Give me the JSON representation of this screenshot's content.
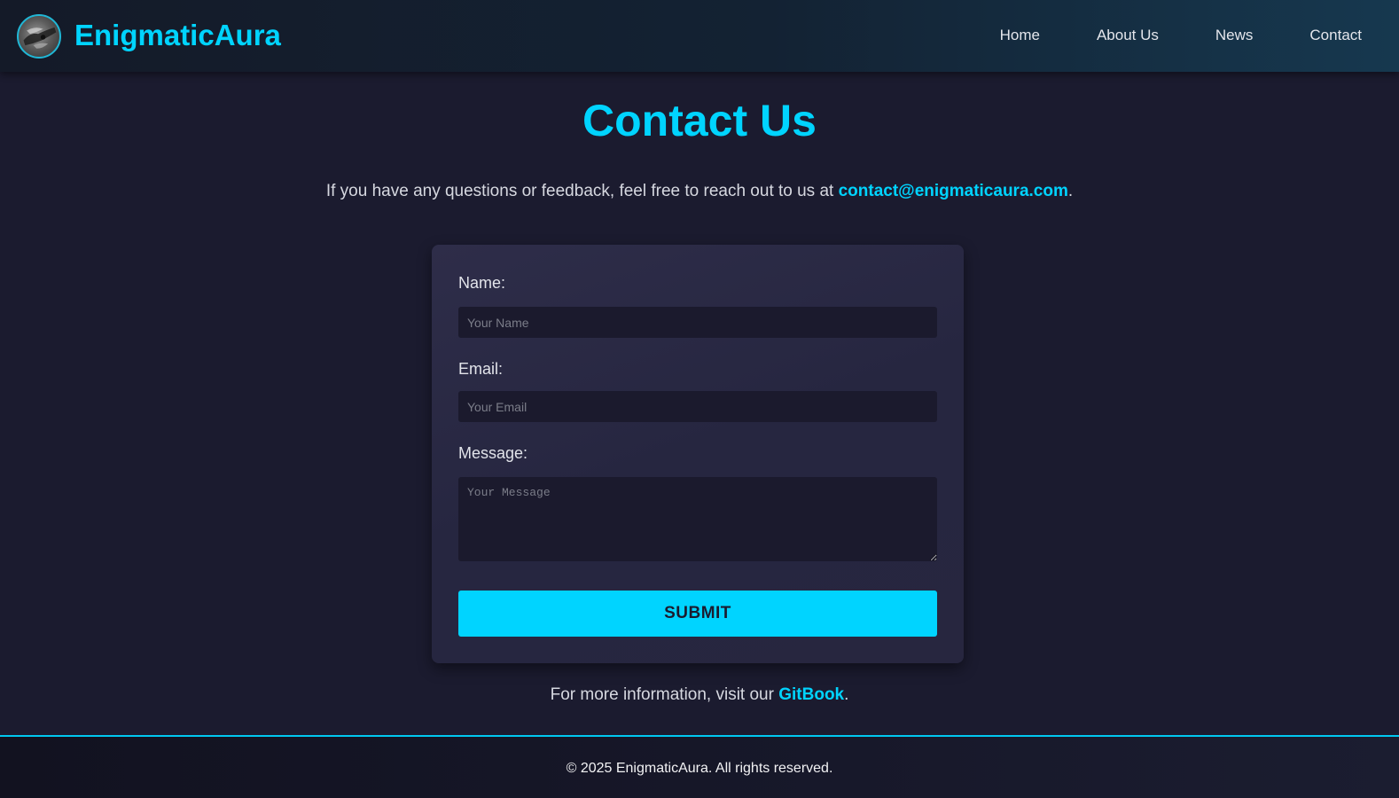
{
  "header": {
    "brand": "EnigmaticAura",
    "nav": [
      {
        "label": "Home"
      },
      {
        "label": "About Us"
      },
      {
        "label": "News"
      },
      {
        "label": "Contact"
      }
    ]
  },
  "main": {
    "title": "Contact Us",
    "intro_text": "If you have any questions or feedback, feel free to reach out to us at ",
    "intro_email": "contact@enigmaticaura.com",
    "intro_end": ".",
    "form": {
      "name_label": "Name:",
      "name_placeholder": "Your Name",
      "email_label": "Email:",
      "email_placeholder": "Your Email",
      "message_label": "Message:",
      "message_placeholder": "Your Message",
      "submit_label": "SUBMIT"
    },
    "more_info_text": "For more information, visit our ",
    "more_info_link": "GitBook",
    "more_info_end": "."
  },
  "footer": {
    "copyright": "© 2025 EnigmaticAura. All rights reserved."
  },
  "colors": {
    "accent": "#00d4ff",
    "background": "#1b1b2f",
    "card": "#2a2944"
  },
  "icons": {
    "logo": "logo-icon"
  }
}
